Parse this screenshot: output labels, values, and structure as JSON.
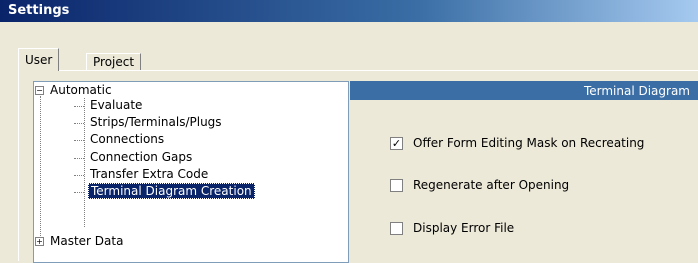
{
  "window": {
    "title": "Settings"
  },
  "tabs": [
    {
      "label": "User"
    },
    {
      "label": "Project"
    }
  ],
  "tree": {
    "items": [
      {
        "label": "Automatic"
      },
      {
        "label": "Evaluate"
      },
      {
        "label": "Strips/Terminals/Plugs"
      },
      {
        "label": "Connections"
      },
      {
        "label": "Connection Gaps"
      },
      {
        "label": "Transfer Extra Code"
      },
      {
        "label": "Terminal Diagram Creation"
      },
      {
        "label": "Master Data"
      }
    ]
  },
  "panel": {
    "header": "Terminal Diagram",
    "checkboxes": [
      {
        "label": "Offer Form Editing Mask on Recreating",
        "checked": true
      },
      {
        "label": "Regenerate after Opening",
        "checked": false
      },
      {
        "label": "Display Error File",
        "checked": false
      }
    ]
  }
}
